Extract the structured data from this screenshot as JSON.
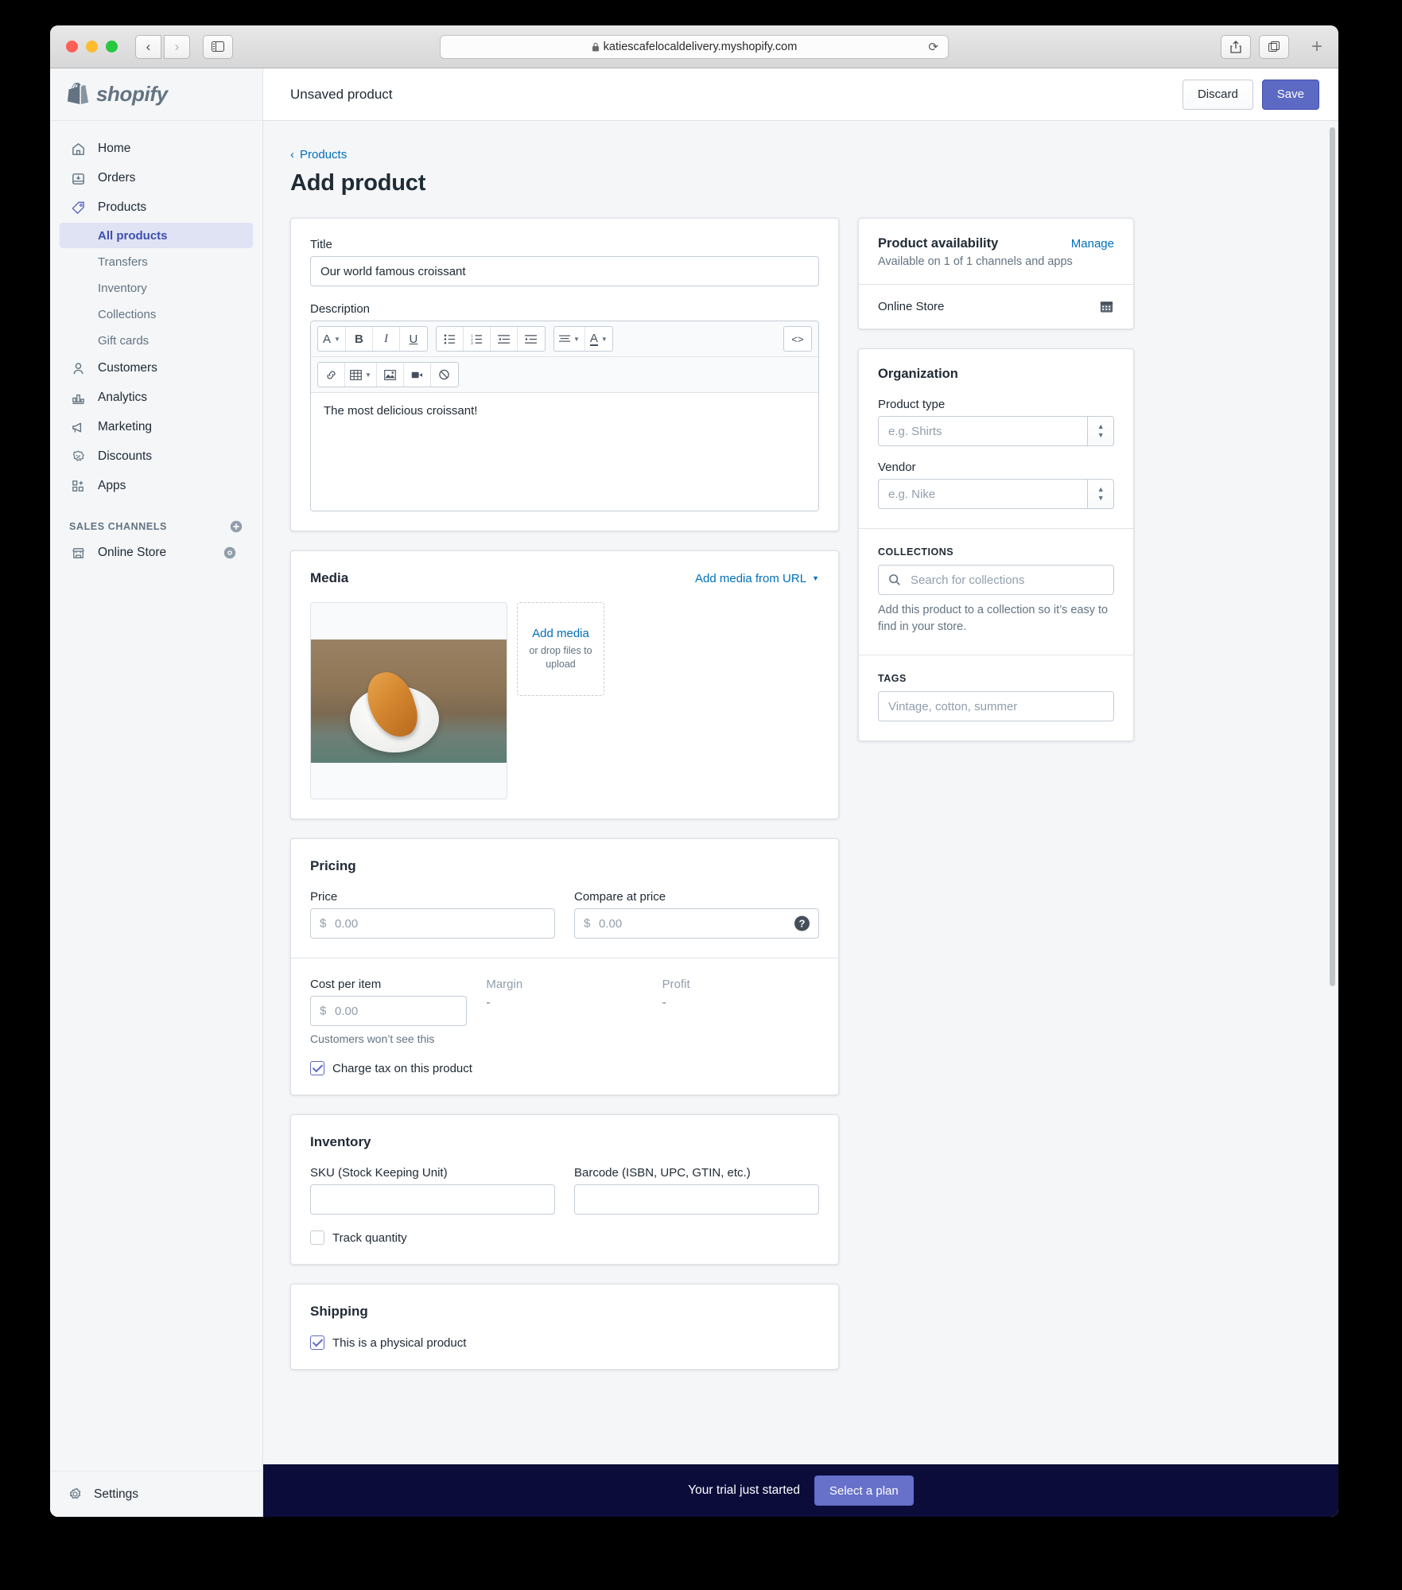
{
  "browser": {
    "url": "katiescafelocaldelivery.myshopify.com",
    "lock_icon": "lock-icon",
    "reload_icon": "reload-icon",
    "back_icon": "chevron-left-icon",
    "forward_icon": "chevron-right-icon",
    "sidebar_icon": "sidebar-toggle-icon",
    "share_icon": "share-icon",
    "tabs_icon": "tabs-overview-icon",
    "new_tab_icon": "plus-icon"
  },
  "sidebar": {
    "brand": "shopify",
    "items": [
      {
        "label": "Home",
        "icon": "home-icon"
      },
      {
        "label": "Orders",
        "icon": "orders-inbox-icon"
      },
      {
        "label": "Products",
        "icon": "products-tag-icon"
      }
    ],
    "product_subitems": [
      {
        "label": "All products",
        "active": true
      },
      {
        "label": "Transfers",
        "active": false
      },
      {
        "label": "Inventory",
        "active": false
      },
      {
        "label": "Collections",
        "active": false
      },
      {
        "label": "Gift cards",
        "active": false
      }
    ],
    "items_after": [
      {
        "label": "Customers",
        "icon": "customer-person-icon"
      },
      {
        "label": "Analytics",
        "icon": "analytics-bar-chart-icon"
      },
      {
        "label": "Marketing",
        "icon": "marketing-megaphone-icon"
      },
      {
        "label": "Discounts",
        "icon": "discount-percent-icon"
      },
      {
        "label": "Apps",
        "icon": "apps-grid-plus-icon"
      }
    ],
    "sales_channels_label": "SALES CHANNELS",
    "sales_channels_add_icon": "plus-circle-icon",
    "online_store": {
      "label": "Online Store",
      "icon": "storefront-icon",
      "action_icon": "eye-icon"
    },
    "settings": {
      "label": "Settings",
      "icon": "gear-icon"
    }
  },
  "topbar": {
    "title": "Unsaved product",
    "discard_label": "Discard",
    "save_label": "Save"
  },
  "page": {
    "breadcrumb": "Products",
    "breadcrumb_icon": "chevron-left-icon",
    "title": "Add product"
  },
  "product_form": {
    "title_label": "Title",
    "title_value": "Our world famous croissant",
    "description_label": "Description",
    "description_value": "The most delicious croissant!",
    "toolbar_row1": [
      {
        "glyph": "A",
        "name": "font-style-icon",
        "caret": true
      },
      {
        "glyph": "B",
        "name": "bold-icon",
        "caret": false
      },
      {
        "glyph": "I",
        "name": "italic-icon",
        "caret": false
      },
      {
        "glyph": "U",
        "name": "underline-icon",
        "caret": false
      }
    ],
    "toolbar_lists": [
      {
        "glyph": "☰",
        "name": "bulleted-list-icon"
      },
      {
        "glyph": "☰",
        "name": "numbered-list-icon"
      },
      {
        "glyph": "⇤",
        "name": "outdent-icon"
      },
      {
        "glyph": "⇥",
        "name": "indent-icon"
      }
    ],
    "toolbar_align": [
      {
        "glyph": "≡",
        "name": "align-icon",
        "caret": true
      },
      {
        "glyph": "A",
        "name": "text-color-icon",
        "caret": true
      }
    ],
    "toolbar_code": {
      "glyph": "<>",
      "name": "html-code-icon"
    },
    "toolbar_row2": [
      {
        "glyph": "🔗",
        "name": "insert-link-icon",
        "caret": false
      },
      {
        "glyph": "▦",
        "name": "insert-table-icon",
        "caret": true
      },
      {
        "glyph": "🖼",
        "name": "insert-image-icon",
        "caret": false
      },
      {
        "glyph": "🎬",
        "name": "insert-video-icon",
        "caret": false
      },
      {
        "glyph": "⊘",
        "name": "clear-formatting-icon",
        "caret": false
      }
    ]
  },
  "media": {
    "heading": "Media",
    "add_from_url": "Add media from URL",
    "add_from_url_icon": "chevron-down-icon",
    "thumbnail_alt": "croissant-on-plate-photo",
    "dropzone_link": "Add media",
    "dropzone_sub": "or drop files to upload"
  },
  "pricing": {
    "heading": "Pricing",
    "price_label": "Price",
    "price_placeholder": "0.00",
    "price_currency": "$",
    "compare_label": "Compare at price",
    "compare_placeholder": "0.00",
    "compare_currency": "$",
    "compare_help_icon": "help-question-icon",
    "cost_label": "Cost per item",
    "cost_placeholder": "0.00",
    "cost_currency": "$",
    "cost_note": "Customers won’t see this",
    "margin_label": "Margin",
    "margin_value": "-",
    "profit_label": "Profit",
    "profit_value": "-",
    "charge_tax_label": "Charge tax on this product",
    "charge_tax_checked": true
  },
  "inventory": {
    "heading": "Inventory",
    "sku_label": "SKU (Stock Keeping Unit)",
    "sku_value": "",
    "barcode_label": "Barcode (ISBN, UPC, GTIN, etc.)",
    "barcode_value": "",
    "track_quantity_label": "Track quantity",
    "track_quantity_checked": false
  },
  "shipping": {
    "heading": "Shipping",
    "physical_label": "This is a physical product",
    "physical_checked": true
  },
  "availability": {
    "heading": "Product availability",
    "manage_label": "Manage",
    "subtitle": "Available on 1 of 1 channels and apps",
    "channel_name": "Online Store",
    "channel_icon": "calendar-icon"
  },
  "organization": {
    "heading": "Organization",
    "product_type_label": "Product type",
    "product_type_placeholder": "e.g. Shirts",
    "product_type_value": "",
    "vendor_label": "Vendor",
    "vendor_placeholder": "e.g. Nike",
    "vendor_value": "",
    "collections_label": "COLLECTIONS",
    "collections_placeholder": "Search for collections",
    "collections_search_icon": "search-icon",
    "collections_note": "Add this product to a collection so it’s easy to find in your store.",
    "tags_label": "TAGS",
    "tags_placeholder": "Vintage, cotton, summer",
    "tags_value": ""
  },
  "trial_banner": {
    "message": "Your trial just started",
    "cta_label": "Select a plan"
  },
  "colors": {
    "accent": "#5c6ac4",
    "link": "#006fbb",
    "sidebar_bg": "#f4f6f8",
    "banner_bg": "#0b0c3a",
    "active_nav_bg": "#dfe3f3",
    "active_nav_text": "#3f4eae"
  }
}
